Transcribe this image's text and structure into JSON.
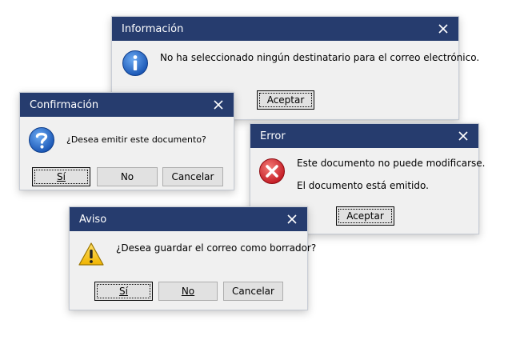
{
  "info": {
    "title": "Información",
    "message": "No ha seleccionado ningún destinatario para el correo electrónico.",
    "ok_label": "Aceptar",
    "icon": "information-icon"
  },
  "confirm": {
    "title": "Confirmación",
    "message": "¿Desea emitir este documento?",
    "yes_label": "Sí",
    "no_label": "No",
    "cancel_label": "Cancelar",
    "icon": "question-icon"
  },
  "error": {
    "title": "Error",
    "message_line1": "Este documento no puede modificarse.",
    "message_line2": "El documento está emitido.",
    "ok_label": "Aceptar",
    "icon": "error-icon"
  },
  "warning": {
    "title": "Aviso",
    "message": "¿Desea guardar el correo como borrador?",
    "yes_label": "Sí",
    "no_label": "No",
    "cancel_label": "Cancelar",
    "icon": "warning-icon"
  },
  "colors": {
    "titlebar": "#263c6e",
    "dialog_bg": "#f0f0f0",
    "button_bg": "#e1e1e1",
    "info_blue": "#1b63c6",
    "error_red": "#d0202a",
    "warning_yellow": "#f4c20d"
  }
}
